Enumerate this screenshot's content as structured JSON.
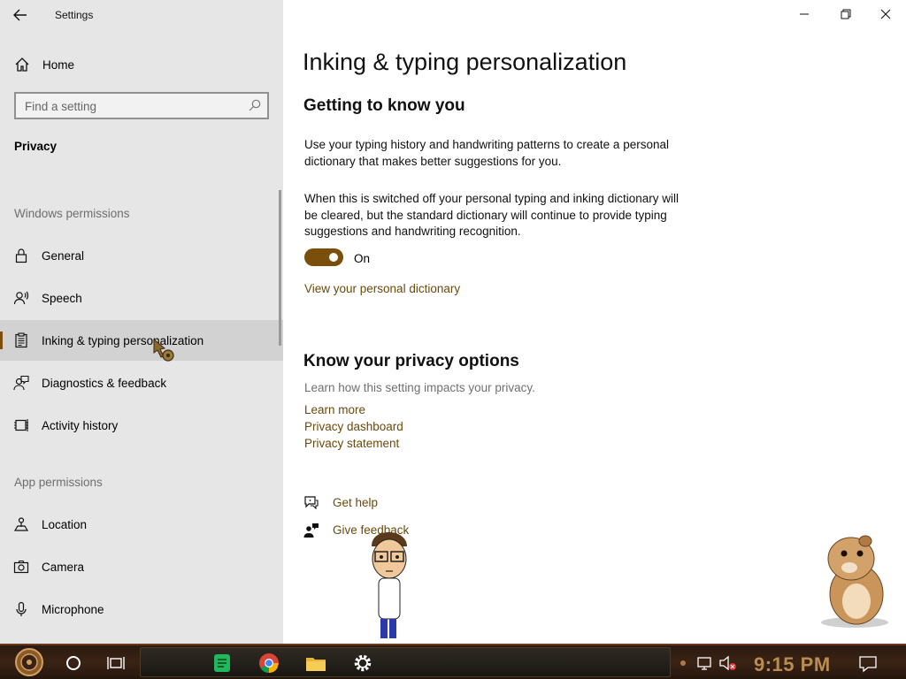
{
  "window": {
    "title": "Settings"
  },
  "sidebar": {
    "home_label": "Home",
    "search_placeholder": "Find a setting",
    "section_title": "Privacy",
    "windows_permissions_header": "Windows permissions",
    "windows_items": [
      {
        "label": "General",
        "icon": "lock-icon"
      },
      {
        "label": "Speech",
        "icon": "speech-icon"
      },
      {
        "label": "Inking & typing personalization",
        "icon": "clipboard-icon",
        "selected": true
      },
      {
        "label": "Diagnostics & feedback",
        "icon": "feedback-person-icon"
      },
      {
        "label": "Activity history",
        "icon": "activity-history-icon"
      }
    ],
    "app_permissions_header": "App permissions",
    "app_items": [
      {
        "label": "Location",
        "icon": "location-icon"
      },
      {
        "label": "Camera",
        "icon": "camera-icon"
      },
      {
        "label": "Microphone",
        "icon": "microphone-icon"
      }
    ]
  },
  "main": {
    "title": "Inking & typing personalization",
    "section1_heading": "Getting to know you",
    "para1": "Use your typing history and handwriting patterns to create a personal dictionary that makes better suggestions for you.",
    "para2": "When this is switched off your personal typing and inking dictionary will be cleared, but the standard dictionary will continue to provide typing suggestions and handwriting recognition.",
    "toggle_state": "On",
    "dictionary_link": "View your personal dictionary",
    "section2_heading": "Know your privacy options",
    "privacy_desc": "Learn how this setting impacts your privacy.",
    "privacy_links": [
      "Learn more",
      "Privacy dashboard",
      "Privacy statement"
    ],
    "help_links": [
      "Get help",
      "Give feedback"
    ]
  },
  "taskbar": {
    "clock": "9:15 PM"
  },
  "colors": {
    "accent": "#7a4f0c",
    "link": "#6b4a0a",
    "sidebar_bg": "#e6e6e6",
    "clock": "#b98c52"
  }
}
